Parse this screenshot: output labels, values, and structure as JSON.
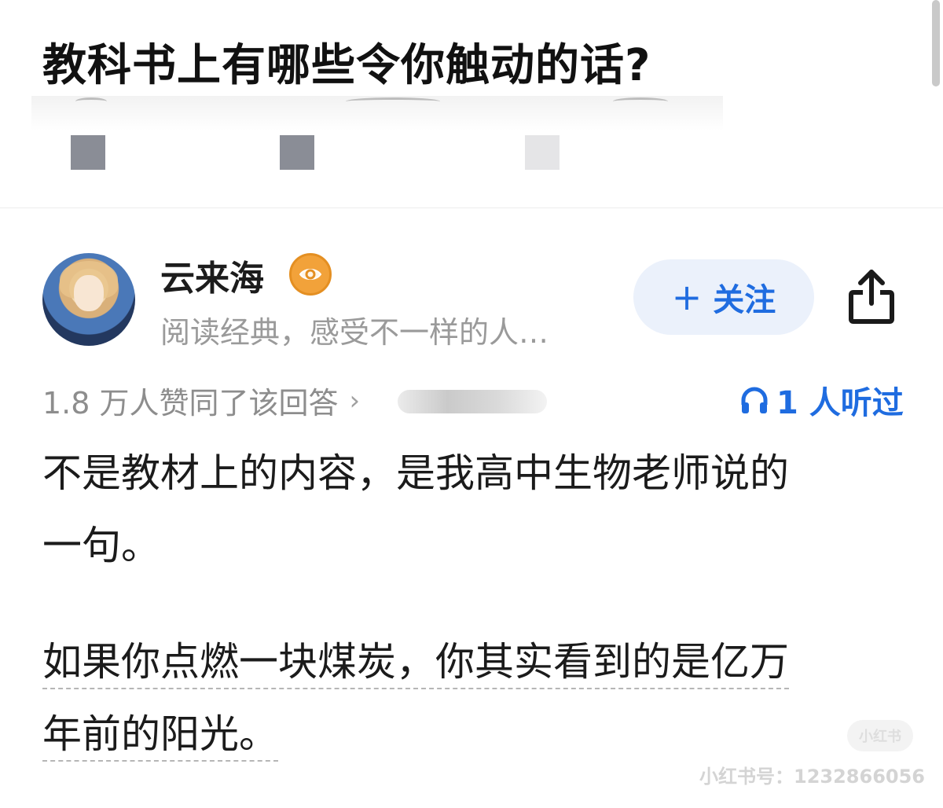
{
  "question": {
    "title": "教科书上有哪些令你触动的话?"
  },
  "author": {
    "name": "云来海",
    "bio": "阅读经典，感受不一样的人…",
    "badge_icon": "eye-badge-icon"
  },
  "actions": {
    "follow_label": "关注",
    "follow_icon": "plus-icon",
    "share_icon": "share-icon"
  },
  "stats": {
    "approvals": "1.8 万人赞同了该回答",
    "chevron": "›",
    "listeners": "1 人听过",
    "listen_icon": "headphones-icon"
  },
  "answer": {
    "paragraph1_line1": "不是教材上的内容，是我高中生物老师说的",
    "paragraph1_line2": "一句。",
    "paragraph2_line1": "如果你点燃一块煤炭，你其实看到的是亿万",
    "paragraph2_line2": "年前的阳光。"
  },
  "watermark": {
    "logo": "小红书",
    "id_text": "小红书号：1232866056"
  },
  "colors": {
    "accent": "#1f6ce0",
    "follow_bg": "#ebf1fb",
    "badge": "#f2a23a",
    "muted": "#9a9a9a"
  }
}
